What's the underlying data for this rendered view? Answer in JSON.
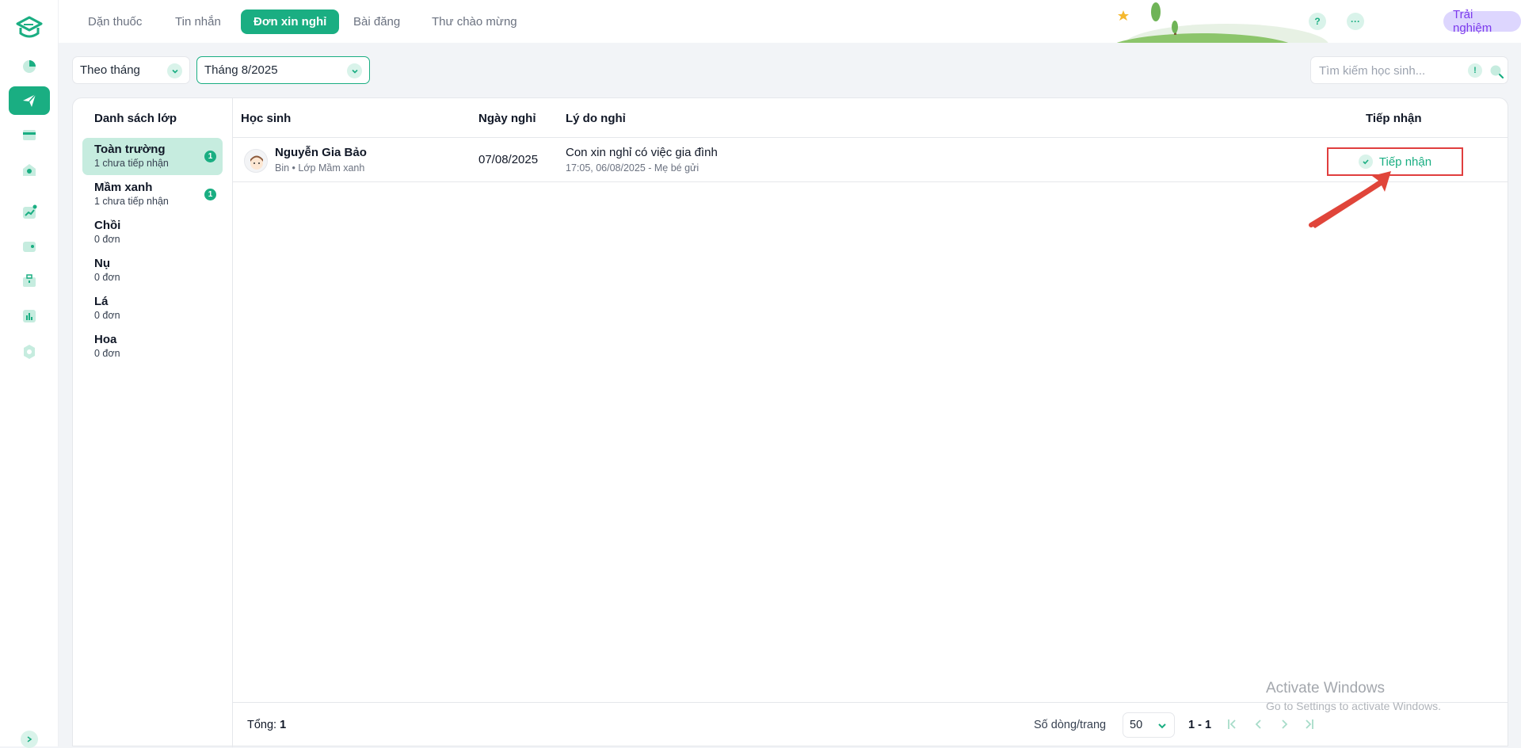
{
  "topbar": {
    "tabs": [
      {
        "label": "Dặn thuốc",
        "active": false
      },
      {
        "label": "Tin nhắn",
        "active": false
      },
      {
        "label": "Đơn xin nghỉ",
        "active": true
      },
      {
        "label": "Bài đăng",
        "active": false
      },
      {
        "label": "Thư chào mừng",
        "active": false
      }
    ],
    "help_label": "?",
    "more_label": "···",
    "trial_label": "Trải nghiệm"
  },
  "filters": {
    "period_type": "Theo tháng",
    "month": "Tháng 8/2025",
    "search_placeholder": "Tìm kiếm học sinh...",
    "search_info_label": "!"
  },
  "classes": {
    "title": "Danh sách lớp",
    "items": [
      {
        "name": "Toàn trường",
        "sub": "1 chưa tiếp nhận",
        "badge": "1",
        "active": true
      },
      {
        "name": "Mầm xanh",
        "sub": "1 chưa tiếp nhận",
        "badge": "1",
        "active": false
      },
      {
        "name": "Chồi",
        "sub": "0 đơn",
        "badge": "",
        "active": false
      },
      {
        "name": "Nụ",
        "sub": "0 đơn",
        "badge": "",
        "active": false
      },
      {
        "name": "Lá",
        "sub": "0 đơn",
        "badge": "",
        "active": false
      },
      {
        "name": "Hoa",
        "sub": "0 đơn",
        "badge": "",
        "active": false
      }
    ]
  },
  "table": {
    "headers": {
      "student": "Học sinh",
      "date": "Ngày nghỉ",
      "reason": "Lý do nghỉ",
      "accept": "Tiếp nhận"
    },
    "rows": [
      {
        "student_name": "Nguyễn Gia Bảo",
        "student_sub": "Bin • Lớp Mầm xanh",
        "date": "07/08/2025",
        "reason": "Con xin nghỉ có việc gia đình",
        "reason_sub": "17:05, 06/08/2025 - Mẹ bé gửi",
        "accept_label": "Tiếp nhận"
      }
    ]
  },
  "footer": {
    "total_label": "Tổng:",
    "total_value": "1",
    "rows_per_page_label": "Số dòng/trang",
    "rows_per_page": "50",
    "range": "1 - 1"
  },
  "watermark": {
    "line1": "Activate Windows",
    "line2": "Go to Settings to activate Windows."
  },
  "colors": {
    "accent": "#1aae82",
    "accent_light": "#d9f3ea",
    "highlight_border": "#e03e3e",
    "trial_bg": "#ddd6fe"
  }
}
